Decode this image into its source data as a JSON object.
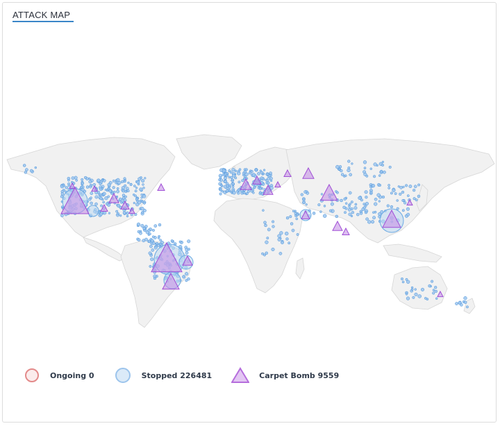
{
  "header": {
    "title": "ATTACK MAP"
  },
  "colors": {
    "accent": "#3a86c8",
    "land": "#f1f1f1",
    "land_border": "#d6d6d6",
    "ongoing": "#e38a8a",
    "stopped_fill": "#bcd8f2",
    "stopped_stroke": "#6aa9e3",
    "carpet_fill": "#c792e6",
    "carpet_stroke": "#a04fd6"
  },
  "legend": {
    "ongoing": {
      "label": "Ongoing",
      "count": "0",
      "icon": "circle-red-icon"
    },
    "stopped": {
      "label": "Stopped",
      "count": "226481",
      "icon": "circle-blue-icon"
    },
    "carpet": {
      "label": "Carpet Bomb",
      "count": "9559",
      "icon": "triangle-purple-icon"
    }
  },
  "legend_text": {
    "ongoing": "Ongoing 0",
    "stopped": "Stopped 226481",
    "carpet": "Carpet Bomb 9559"
  }
}
